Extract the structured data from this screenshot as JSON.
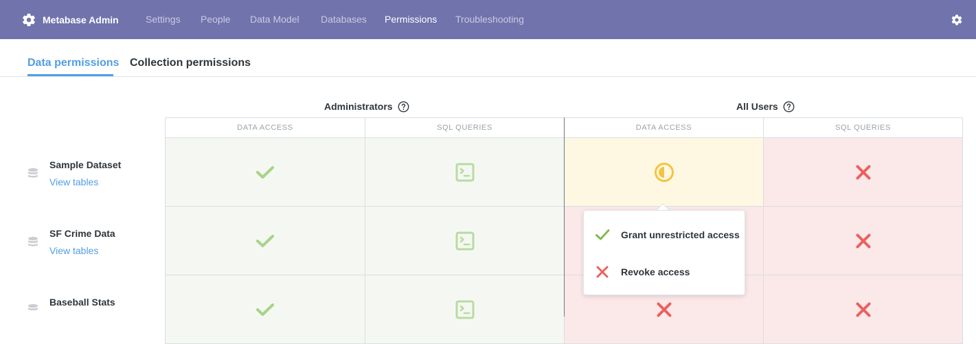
{
  "app": {
    "title": "Metabase Admin"
  },
  "nav": {
    "items": [
      {
        "label": "Settings",
        "active": false
      },
      {
        "label": "People",
        "active": false
      },
      {
        "label": "Data Model",
        "active": false
      },
      {
        "label": "Databases",
        "active": false
      },
      {
        "label": "Permissions",
        "active": true
      },
      {
        "label": "Troubleshooting",
        "active": false
      }
    ]
  },
  "tabs": [
    {
      "label": "Data permissions",
      "active": true
    },
    {
      "label": "Collection permissions",
      "active": false
    }
  ],
  "groups": [
    {
      "name": "Administrators",
      "columns": [
        "DATA ACCESS",
        "SQL QUERIES"
      ]
    },
    {
      "name": "All Users",
      "columns": [
        "DATA ACCESS",
        "SQL QUERIES"
      ]
    }
  ],
  "databases": [
    {
      "name": "Sample Dataset",
      "link": "View tables",
      "cells": [
        "granted",
        "native",
        "partial",
        "revoked"
      ]
    },
    {
      "name": "SF Crime Data",
      "link": "View tables",
      "cells": [
        "granted",
        "native",
        "revoked",
        "revoked"
      ]
    },
    {
      "name": "Baseball Stats",
      "link": "View tables",
      "cells": [
        "granted",
        "native",
        "revoked",
        "revoked"
      ]
    }
  ],
  "popover": {
    "options": [
      {
        "label": "Grant unrestricted access",
        "icon": "check-icon"
      },
      {
        "label": "Revoke access",
        "icon": "close-icon"
      }
    ]
  },
  "colors": {
    "nav_bg": "#7173ad",
    "brand_blue": "#509ee3",
    "granted": "#9ccf74",
    "granted_bg": "#f5f8f2",
    "partial": "#f4c342",
    "partial_bg": "#fef8e2",
    "revoked": "#ec5f5f",
    "revoked_bg": "#fbe8e8"
  }
}
